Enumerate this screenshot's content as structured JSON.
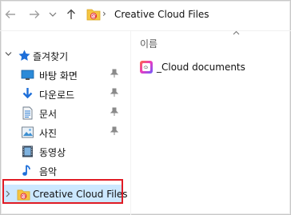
{
  "address_bar": {
    "back_icon": "arrow-left-icon",
    "forward_icon": "arrow-right-icon",
    "recent_icon": "chevron-down-icon",
    "up_icon": "arrow-up-icon",
    "separator": "›",
    "path": "Creative Cloud Files"
  },
  "sidebar": {
    "quick_access": {
      "label": "즐겨찾기",
      "icon": "star-icon",
      "color": "#1e6fd9"
    },
    "items": [
      {
        "label": "바탕 화면",
        "icon": "desktop-icon",
        "pinned": true
      },
      {
        "label": "다운로드",
        "icon": "download-icon",
        "pinned": true
      },
      {
        "label": "문서",
        "icon": "document-icon",
        "pinned": true
      },
      {
        "label": "사진",
        "icon": "pictures-icon",
        "pinned": true
      },
      {
        "label": "동영상",
        "icon": "video-icon",
        "pinned": false
      },
      {
        "label": "음악",
        "icon": "music-icon",
        "pinned": false
      }
    ],
    "creative_cloud": {
      "label": "Creative Cloud Files",
      "icon": "creative-cloud-folder-icon",
      "selected": true,
      "highlight_color": "#e01b24"
    }
  },
  "content": {
    "column_header": "이름",
    "files": [
      {
        "name": "_Cloud documents",
        "icon": "cloud-documents-icon"
      }
    ]
  }
}
